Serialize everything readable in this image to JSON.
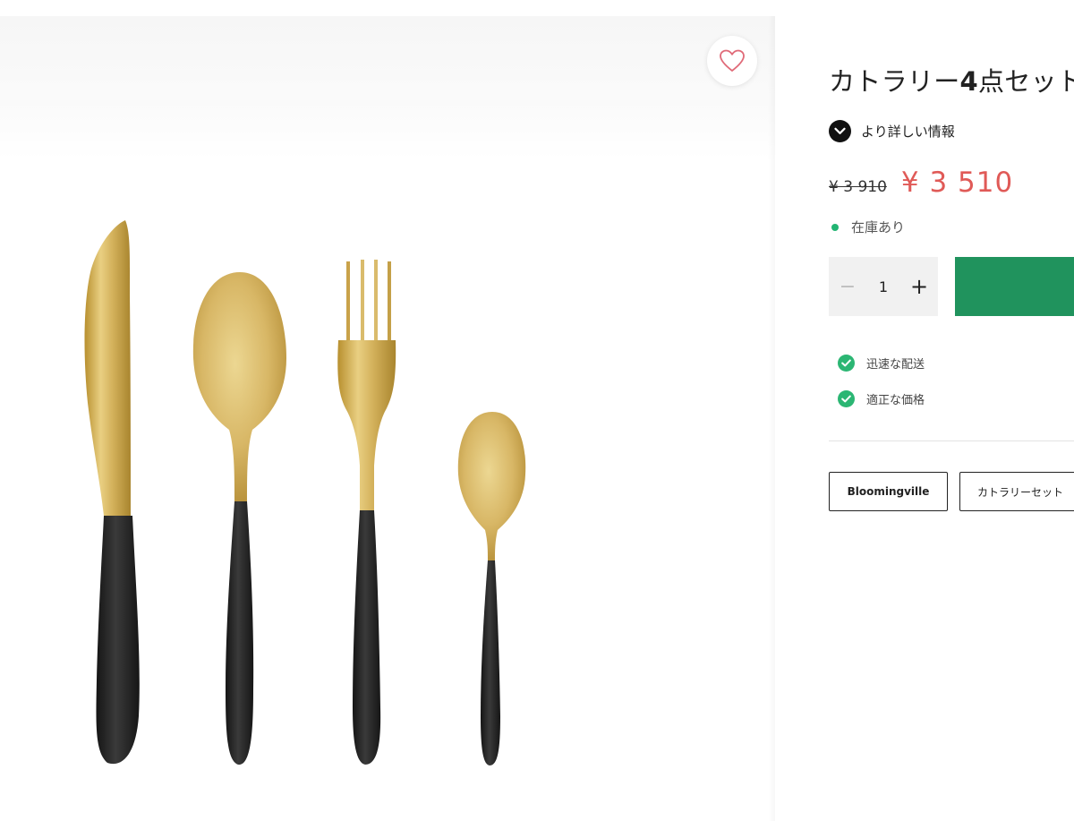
{
  "product": {
    "title_part1": "カトラリー",
    "title_part2": "4",
    "title_part3": "点セット",
    "more_info_label": "より詳しい情報",
    "price_old": "¥ 3 910",
    "price_new": "¥ 3 510",
    "stock_status": "在庫あり",
    "quantity": "1",
    "quantity_minus": "−",
    "quantity_plus": "+",
    "perks": [
      "迅速な配送",
      "適正な価格"
    ],
    "tags": [
      "Bloomingville",
      "カトラリーセット"
    ]
  },
  "image": {
    "alt": "Gold cutlery set with black handles: knife, spoon, fork, teaspoon",
    "items": [
      "knife",
      "spoon",
      "fork",
      "teaspoon"
    ]
  },
  "icons": {
    "wishlist": "heart-icon",
    "more_info": "chevron-down-icon",
    "perk": "check-circle-icon",
    "stock": "status-dot"
  },
  "colors": {
    "price_sale": "#e05a57",
    "accent_green": "#20935d",
    "stock_dot": "#22b573",
    "check": "#2bb673",
    "heart": "#e06a78",
    "gold": "#c9a24a",
    "handle": "#1f1f1f"
  }
}
